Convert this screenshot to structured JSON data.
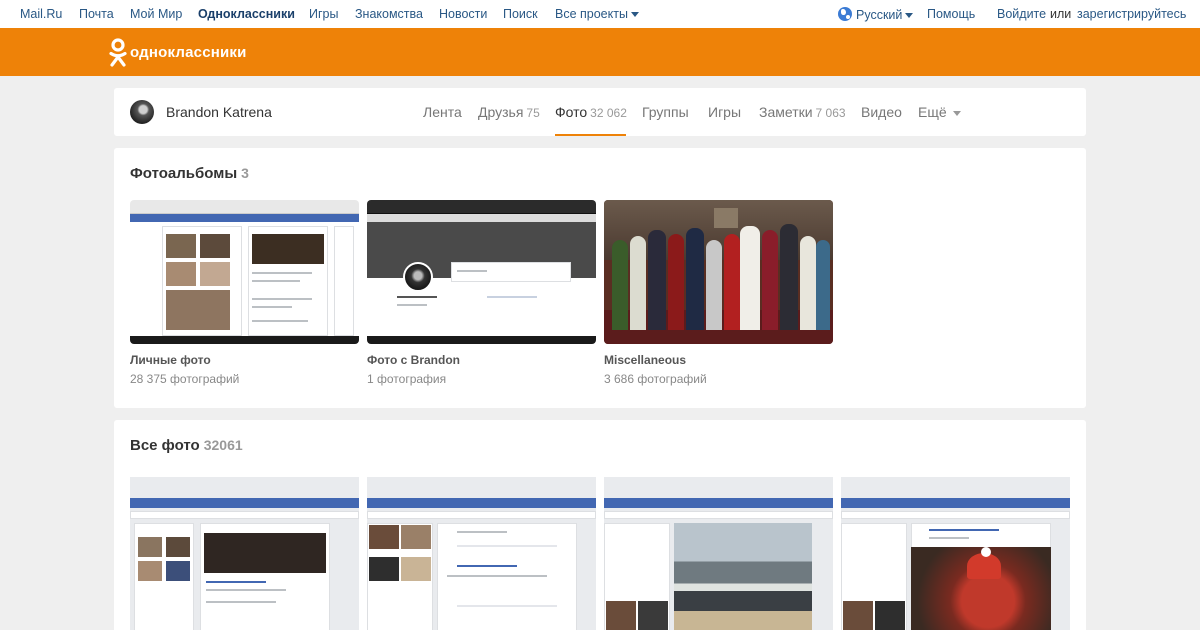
{
  "portal": {
    "links": [
      "Mail.Ru",
      "Почта",
      "Мой Мир",
      "Одноклассники",
      "Игры",
      "Знакомства",
      "Новости",
      "Поиск",
      "Все проекты"
    ],
    "language": "Русский",
    "help": "Помощь",
    "login": "Войдите",
    "or": "или",
    "register": "зарегистрируйтесь"
  },
  "brand": {
    "name": "одноклассники",
    "color": "#ee8208"
  },
  "profile": {
    "name": "Brandon Katrena",
    "tabs": [
      {
        "label": "Лента",
        "count": ""
      },
      {
        "label": "Друзья",
        "count": "75"
      },
      {
        "label": "Фото",
        "count": "32 062"
      },
      {
        "label": "Группы",
        "count": ""
      },
      {
        "label": "Игры",
        "count": ""
      },
      {
        "label": "Заметки",
        "count": "7 063"
      },
      {
        "label": "Видео",
        "count": ""
      },
      {
        "label": "Ещё",
        "count": ""
      }
    ]
  },
  "albums": {
    "title": "Фотоальбомы",
    "count": "3",
    "items": [
      {
        "name": "Личные фото",
        "count": "28 375 фотографий",
        "thumb": "facebook-screenshot"
      },
      {
        "name": "Фото с Brandon",
        "count": "1 фотография",
        "thumb": "profile-screenshot"
      },
      {
        "name": "Miscellaneous",
        "count": "3 686 фотографий",
        "thumb": "group-photo"
      }
    ]
  },
  "all_photos": {
    "title": "Все фото",
    "count": "32061",
    "items": [
      "facebook-timeline-screenshot",
      "facebook-comments-screenshot",
      "facebook-beach-screenshot",
      "facebook-santa-hat-screenshot"
    ]
  }
}
